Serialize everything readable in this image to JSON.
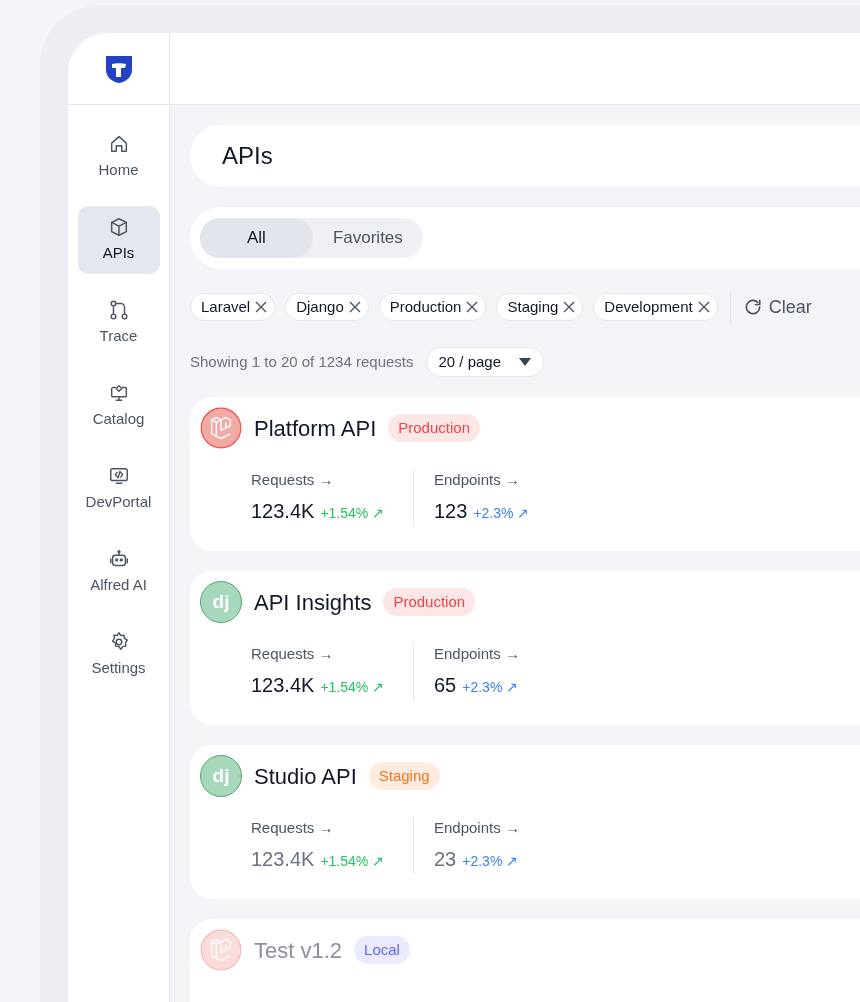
{
  "sidebar": {
    "items": [
      {
        "label": "Home",
        "selected": false
      },
      {
        "label": "APIs",
        "selected": true
      },
      {
        "label": "Trace",
        "selected": false
      },
      {
        "label": "Catalog",
        "selected": false
      },
      {
        "label": "DevPortal",
        "selected": false
      },
      {
        "label": "Alfred AI",
        "selected": false
      },
      {
        "label": "Settings",
        "selected": false
      }
    ]
  },
  "page_title": "APIs",
  "tabs": [
    {
      "label": "All",
      "selected": true
    },
    {
      "label": "Favorites",
      "selected": false
    }
  ],
  "filters": [
    "Laravel",
    "Django",
    "Production",
    "Staging",
    "Development"
  ],
  "clear_label": "Clear",
  "summary": "Showing 1 to 20 of 1234 requests",
  "page_size": "20 / page",
  "apis": [
    {
      "name": "Platform API",
      "logo": {
        "kind": "laravel"
      },
      "tag": {
        "text": "Production",
        "color": "#ef4444"
      },
      "faded": false,
      "stats": [
        {
          "label": "Requests →",
          "value": "123.4K",
          "change": "+1.54% ↗",
          "color": "#22c55e"
        },
        {
          "label": "Endpoints →",
          "value": "123",
          "change": "+2.3% ↗",
          "color": "#3b82f6"
        }
      ]
    },
    {
      "name": "API Insights",
      "logo": {
        "kind": "django",
        "text": "dj"
      },
      "tag": {
        "text": "Production",
        "color": "#ef4444"
      },
      "faded": false,
      "stats": [
        {
          "label": "Requests →",
          "value": "123.4K",
          "change": "+1.54% ↗",
          "color": "#22c55e"
        },
        {
          "label": "Endpoints →",
          "value": "65",
          "change": "+2.3% ↗",
          "color": "#3b82f6"
        }
      ]
    },
    {
      "name": "Studio API",
      "logo": {
        "kind": "django",
        "text": "dj"
      },
      "tag": {
        "text": "Staging",
        "color": "#f97316"
      },
      "faded": false,
      "stats": [
        {
          "label": "Requests →",
          "value": "123.4K",
          "change": "+1.54% ↗",
          "color": "#22c55e"
        },
        {
          "label": "Endpoints →",
          "value": "23",
          "change": "+2.3% ↗",
          "color": "#3b82f6"
        }
      ]
    },
    {
      "name": "Test v1.2",
      "logo": {
        "kind": "laravel"
      },
      "tag": {
        "text": "Local",
        "color": "#6366f1"
      },
      "faded": true
    }
  ]
}
